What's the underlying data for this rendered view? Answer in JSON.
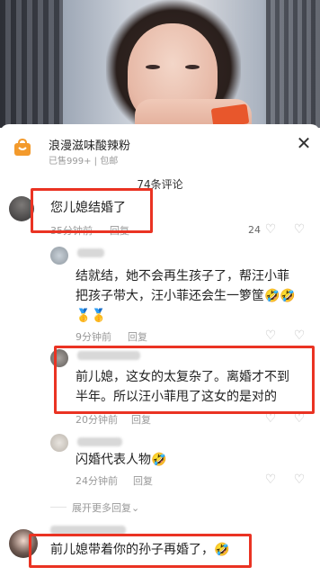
{
  "product": {
    "icon": "shopping-cart-icon",
    "title": "浪漫滋味酸辣粉",
    "subtitle": "已售999+ | 包邮"
  },
  "comments_header": "74条评论",
  "comments": [
    {
      "id": "c1",
      "text": "您儿媳结婚了",
      "time": "35分钟前",
      "reply_label": "回复",
      "likes": "24"
    },
    {
      "id": "r1",
      "text_line1": "结就结，她不会再生孩子了，帮汪小菲",
      "text_line2": "把孩子带大，汪小菲还会生一箩筐🤣🤣",
      "text_line3": "🥇🥇",
      "time": "9分钟前",
      "reply_label": "回复"
    },
    {
      "id": "r2",
      "text_line1": "前儿媳，这女的太复杂了。离婚才不到",
      "text_line2": "半年。所以汪小菲甩了这女的是对的",
      "time": "20分钟前",
      "reply_label": "回复"
    },
    {
      "id": "r3",
      "text": "闪婚代表人物🤣",
      "time": "24分钟前",
      "reply_label": "回复"
    },
    {
      "id": "c2",
      "text": "前儿媳带着你的孙子再婚了，🤣"
    }
  ],
  "expand_more": "展开更多回复⌄",
  "colors": {
    "highlight": "#ea3323",
    "meta_gray": "#999999",
    "cart_orange": "#f39a2c"
  }
}
